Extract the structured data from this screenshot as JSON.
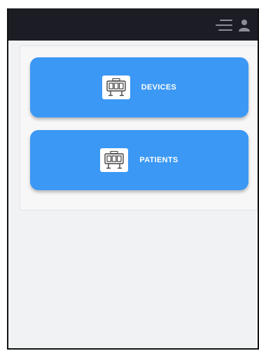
{
  "header": {
    "menu_icon": "hamburger-menu-icon",
    "user_icon": "user-icon",
    "background": "#1c1d24"
  },
  "cards": [
    {
      "label": "DEVICES",
      "icon": "monitor-board-icon",
      "color": "#3b98f4"
    },
    {
      "label": "PATIENTS",
      "icon": "monitor-board-icon",
      "color": "#3b98f4"
    }
  ]
}
